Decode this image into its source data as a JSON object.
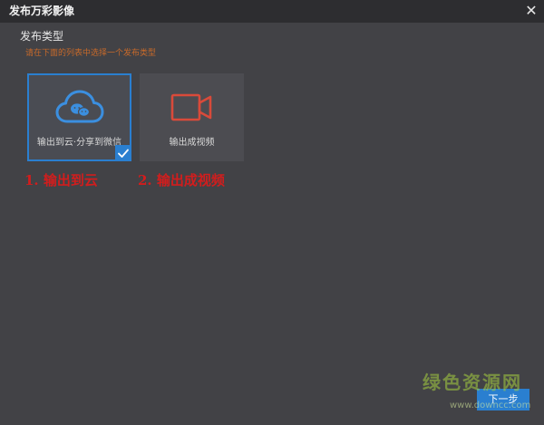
{
  "window": {
    "title": "发布万彩影像",
    "close_glyph": "✕"
  },
  "publish": {
    "heading": "发布类型",
    "hint": "请在下面的列表中选择一个发布类型"
  },
  "options": [
    {
      "label": "输出到云·分享到微信",
      "icon": "cloud-wechat-icon",
      "selected": true,
      "icon_color": "#3b8fe0"
    },
    {
      "label": "输出成视频",
      "icon": "video-camera-icon",
      "selected": false,
      "icon_color": "#d94a3a"
    }
  ],
  "annotations": [
    "1. 输出到云",
    "2. 输出成视频"
  ],
  "footer": {
    "next_label": "下一步"
  },
  "watermark": {
    "text": "绿色资源网",
    "url": "www.downcc.com"
  },
  "colors": {
    "accent": "#2a7fd0",
    "background": "#424246",
    "annotation_red": "#d21d1d",
    "hint_orange": "#c86a2a"
  }
}
